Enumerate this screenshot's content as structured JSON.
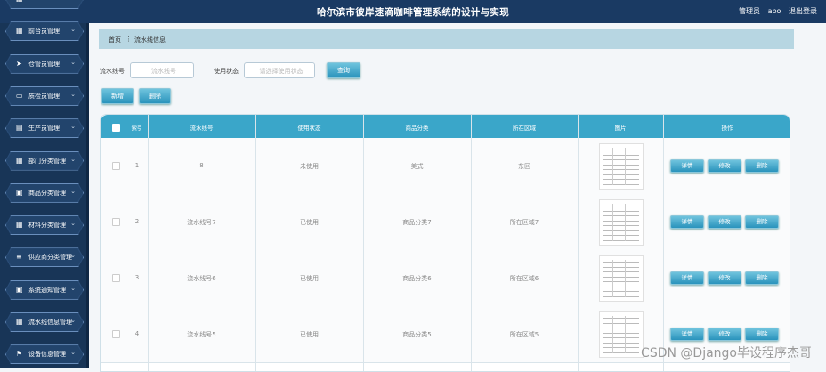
{
  "header": {
    "title": "哈尔滨市彼岸速滴咖啡管理系统的设计与实现",
    "user_role": "管理员",
    "user_name": "abo",
    "logout": "退出登录"
  },
  "sidebar": {
    "items": [
      {
        "label": "",
        "icon": "grid-icon"
      },
      {
        "label": "前台员管理",
        "icon": "grid-icon"
      },
      {
        "label": "仓管员管理",
        "icon": "send-icon"
      },
      {
        "label": "质检员管理",
        "icon": "monitor-icon"
      },
      {
        "label": "生产员管理",
        "icon": "film-icon"
      },
      {
        "label": "部门分类管理",
        "icon": "grid-icon"
      },
      {
        "label": "商品分类管理",
        "icon": "doc-icon"
      },
      {
        "label": "材料分类管理",
        "icon": "grid-icon"
      },
      {
        "label": "供应商分类管理",
        "icon": "list-icon"
      },
      {
        "label": "系统通知管理",
        "icon": "doc-icon"
      },
      {
        "label": "流水线信息管理",
        "icon": "grid-icon"
      },
      {
        "label": "设备信息管理",
        "icon": "flag-icon"
      }
    ]
  },
  "breadcrumb": {
    "home": "首页",
    "separator": "⋮",
    "current": "流水线信息"
  },
  "search": {
    "label1": "流水线号",
    "placeholder1": "流水线号",
    "label2": "使用状态",
    "placeholder2": "请选择使用状态",
    "query_button": "查询"
  },
  "toolbar": {
    "add_button": "新增",
    "delete_button": "删除"
  },
  "table": {
    "columns": [
      "索引",
      "流水线号",
      "使用状态",
      "商品分类",
      "所在区域",
      "图片",
      "操作"
    ],
    "rows": [
      {
        "index": "1",
        "line_no": "8",
        "status": "未使用",
        "category": "美式",
        "area": "东区"
      },
      {
        "index": "2",
        "line_no": "流水线号7",
        "status": "已使用",
        "category": "商品分类7",
        "area": "所在区域7"
      },
      {
        "index": "3",
        "line_no": "流水线号6",
        "status": "已使用",
        "category": "商品分类6",
        "area": "所在区域6"
      },
      {
        "index": "4",
        "line_no": "流水线号5",
        "status": "已使用",
        "category": "商品分类5",
        "area": "所在区域5"
      }
    ],
    "actions": {
      "detail": "详情",
      "edit": "修改",
      "delete": "删除"
    }
  },
  "watermark": "CSDN @Django毕设程序杰哥",
  "colors": {
    "topbar": "#1a3a63",
    "sidebar": "#183557",
    "accent": "#3aa6c9",
    "breadcrumb_bg": "#b7d6e2"
  }
}
